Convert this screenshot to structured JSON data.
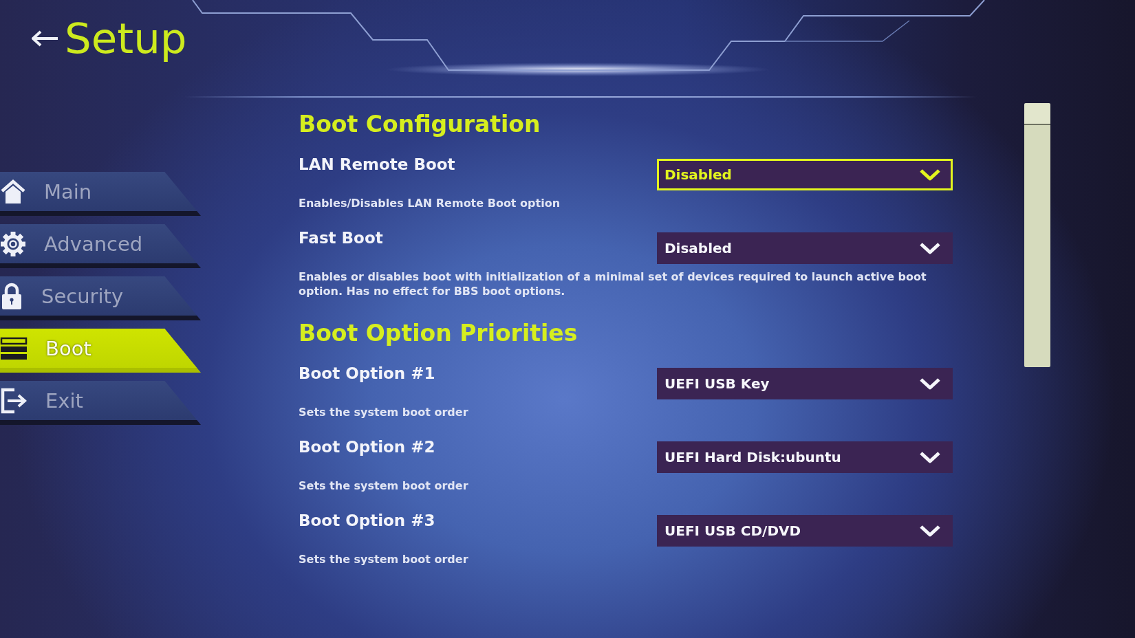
{
  "header": {
    "title": "Setup"
  },
  "sidebar": {
    "items": [
      {
        "label": "Main",
        "selected": false
      },
      {
        "label": "Advanced",
        "selected": false
      },
      {
        "label": "Security",
        "selected": false
      },
      {
        "label": "Boot",
        "selected": true
      },
      {
        "label": "Exit",
        "selected": false
      }
    ]
  },
  "sections": [
    {
      "title": "Boot Configuration",
      "settings": [
        {
          "label": "LAN Remote Boot",
          "description": "Enables/Disables LAN Remote Boot option",
          "value": "Disabled",
          "selected": true
        },
        {
          "label": "Fast Boot",
          "description": "Enables or disables boot with initialization of a minimal set of devices required to launch active boot option. Has no effect for BBS boot options.",
          "value": "Disabled",
          "selected": false
        }
      ]
    },
    {
      "title": "Boot Option Priorities",
      "settings": [
        {
          "label": "Boot Option #1",
          "description": "Sets the system boot order",
          "value": "UEFI USB Key",
          "selected": false
        },
        {
          "label": "Boot Option #2",
          "description": "Sets the system boot order",
          "value": "UEFI Hard Disk:ubuntu",
          "selected": false
        },
        {
          "label": "Boot Option #3",
          "description": "Sets the system boot order",
          "value": "UEFI USB CD/DVD",
          "selected": false
        }
      ]
    }
  ]
}
